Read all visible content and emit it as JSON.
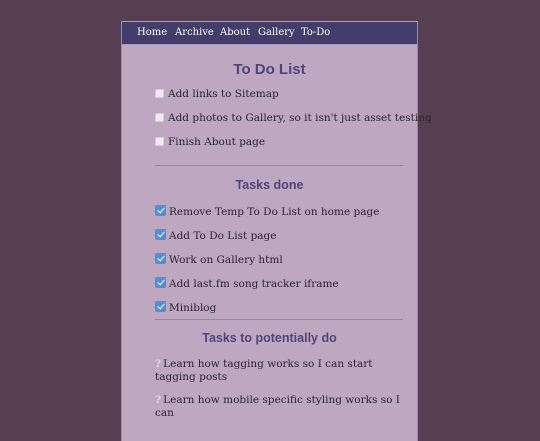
{
  "nav": {
    "items": [
      "Home",
      "Archive",
      "About",
      "Gallery",
      "To-Do"
    ]
  },
  "title": "To Do List",
  "todo": {
    "items": [
      "Add links to Sitemap",
      "Add photos to Gallery, so it isn't just asset testing",
      "Finish About page"
    ]
  },
  "done": {
    "heading": "Tasks done",
    "items": [
      "Remove Temp To Do List on home page",
      "Add To Do List page",
      "Work on Gallery html",
      "Add last.fm song tracker iframe",
      "Miniblog"
    ]
  },
  "potential": {
    "heading": "Tasks to potentially do",
    "items": [
      "Learn how tagging works so I can start tagging posts",
      "Learn how mobile specific styling works so I can"
    ]
  },
  "icons": {
    "unchecked": "empty-checkbox-icon",
    "checked": "check-mark-button-icon",
    "question": "question-mark-icon"
  },
  "colors": {
    "background": "#563f53",
    "panel": "#bda7c1",
    "nav": "#433d6c",
    "heading": "#4f4677",
    "check": "#4f8fd6"
  }
}
